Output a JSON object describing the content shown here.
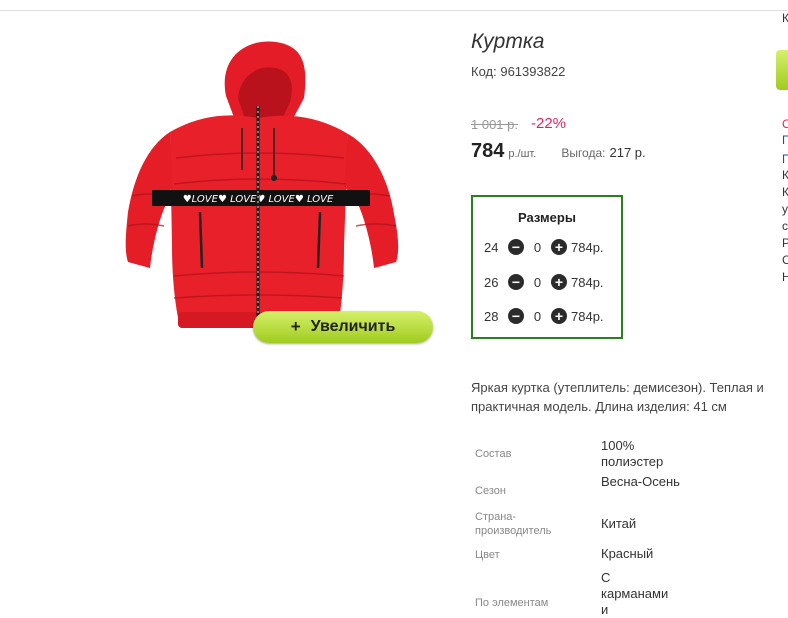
{
  "product": {
    "title": "Куртка",
    "code_label": "Код:",
    "code": "961393822",
    "old_price": "1 001 р.",
    "discount": "-22%",
    "price": "784",
    "price_unit": "р./шт.",
    "savings_label": "Выгода:",
    "savings_value": "217 р.",
    "zoom_label": "Увеличить",
    "zoom_plus": "+"
  },
  "sizes": {
    "title": "Размеры",
    "rows": [
      {
        "size": "24",
        "qty": "0",
        "price": "784р."
      },
      {
        "size": "26",
        "qty": "0",
        "price": "784р."
      },
      {
        "size": "28",
        "qty": "0",
        "price": "784р."
      }
    ]
  },
  "description": {
    "line1": "Яркая куртка (утеплитель: демисезон). Теплая и",
    "line2": "практичная модель. Длина изделия: 41 см"
  },
  "specs": [
    {
      "label": "Состав",
      "value": "100% полиэстер"
    },
    {
      "label": "Сезон",
      "value": "Весна-Осень"
    },
    {
      "label": "Страна-производитель",
      "value": "Китай"
    },
    {
      "label": "Цвет",
      "value": "Красный"
    },
    {
      "label": "По элементам",
      "value": "С карманами и"
    }
  ],
  "right_column": {
    "top_letter": "К",
    "items": [
      {
        "text": "С",
        "color": "#e0245e"
      },
      {
        "text": "П",
        "color": "#1a4fa0"
      },
      {
        "text": "П",
        "color": "#1a4fa0"
      },
      {
        "text": "К",
        "color": "#333333"
      },
      {
        "text": "К",
        "color": "#333333"
      },
      {
        "text": "у",
        "color": "#333333"
      },
      {
        "text": "с",
        "color": "#333333"
      },
      {
        "text": "Р",
        "color": "#333333"
      },
      {
        "text": "С",
        "color": "#333333"
      },
      {
        "text": "Н",
        "color": "#333333"
      }
    ]
  },
  "colors": {
    "accent_green": "#9fcc1f",
    "sizes_border": "#2a7f1e",
    "discount": "#e0245e",
    "jacket_red": "#e8202a"
  }
}
